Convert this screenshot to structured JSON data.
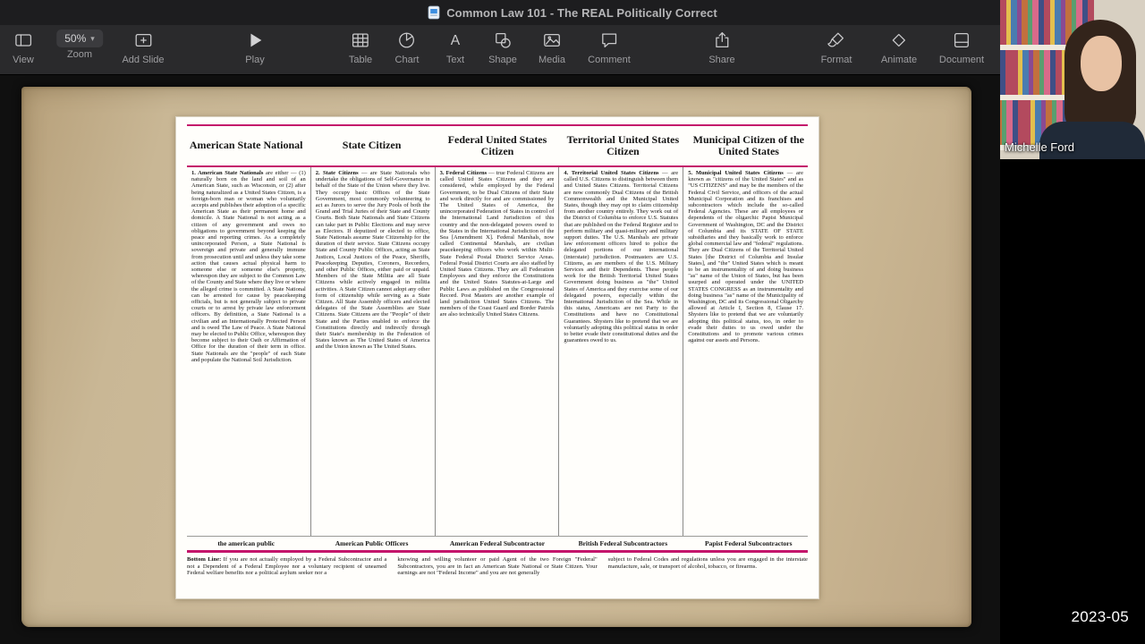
{
  "titlebar": {
    "title": "Common Law 101 - The REAL Politically Correct"
  },
  "toolbar": {
    "view_label": "View",
    "zoom_value": "50%",
    "zoom_label": "Zoom",
    "add_slide_label": "Add Slide",
    "play_label": "Play",
    "table_label": "Table",
    "chart_label": "Chart",
    "text_label": "Text",
    "shape_label": "Shape",
    "media_label": "Media",
    "comment_label": "Comment",
    "share_label": "Share",
    "format_label": "Format",
    "animate_label": "Animate",
    "document_label": "Document"
  },
  "webcam": {
    "name": "Michelle Ford"
  },
  "timestamp": "2023-05",
  "slide": {
    "columns": [
      {
        "header": "American State National",
        "lead": "1. American State Nationals",
        "body": " are either — (1) naturally born on the land and soil of an American State, such as Wisconsin, or (2) after being naturalized as a United States Citizen, is a foreign-born man or woman who voluntarily accepts and publishes their adoption of a specific American State as their permanent home and domicile. A State National is not acting as a citizen of any government and owes no obligations to government beyond keeping the peace and reporting crimes. As a completely unincorporated Person, a State National is sovereign and private and generally immune from prosecution until and unless they take some action that causes actual physical harm to someone else or someone else's property, whereupon they are subject to the Common Law of the County and State where they live or where the alleged crime is committed. A State National can be arrested for cause by peacekeeping officials, but is not generally subject to private courts or to arrest by private law enforcement officers. By definition, a State National is a civilian and an Internationally Protected Person and is owed The Law of Peace. A State National may be elected to Public Office, whereupon they become subject to their Oath or Affirmation of Office for the duration of their term in office. State Nationals are the \"people\" of each State and populate the National Soil Jurisdiction.",
        "footer": "the american public"
      },
      {
        "header": "State Citizen",
        "lead": "2. State Citizens",
        "body": " — are State Nationals who undertake the obligations of Self-Governance in behalf of the State of the Union where they live. They occupy basic Offices of the State Government, most commonly volunteering to act as Jurors to serve the Jury Pools of both the Grand and Trial Juries of their State and County Courts. Both State Nationals and State Citizens can take part in Public Elections and may serve as Electors. If deputized or elected to office, State Nationals assume State Citizenship for the duration of their service. State Citizens occupy State and County Public Offices, acting as State Justices, Local Justices of the Peace, Sheriffs, Peacekeeping Deputies, Coroners, Recorders, and other Public Offices, either paid or unpaid. Members of the State Militia are all State Citizens while actively engaged in militia activities. A State Citizen cannot adopt any other form of citizenship while serving as a State Citizen. All State Assembly officers and elected delegates of the State Assemblies are State Citizens. State Citizens are the \"People\" of their State and the Parties enabled to enforce the Constitutions directly and indirectly through their State's membership in the Federation of States known as The United States of America and the Union known as The United States.",
        "footer": "American Public Officers"
      },
      {
        "header": "Federal United States Citizen",
        "lead": "3. Federal Citizens",
        "body": " — true Federal Citizens are called United States Citizens and they are considered, while employed by the Federal Government, to be Dual Citizens of their State and work directly for and are commissioned by The United States of America, the unincorporated Federation of States in control of the International Land Jurisdiction of this country and the non-delegated powers owed to the States in the International Jurisdiction of the Sea [Amendment X]. Federal Marshals, now called Continental Marshals, are civilian peacekeeping officers who work within Multi-State Federal Postal District Service Areas. Federal Postal District Courts are also staffed by United States Citizens. They are all Federation Employees and they enforce the Constitutions and the United States Statutes-at-Large and Public Laws as published on the Congressional Record. Post Masters are another example of land jurisdiction United States Citizens. The members of the Coast Guard and Border Patrols are also technically United States Citizens.",
        "footer": "American Federal Subcontractor"
      },
      {
        "header": "Territorial United States Citizen",
        "lead": "4. Territorial United States Citizens",
        "body": " — are called U.S. Citizens to distinguish between them and United States Citizens. Territorial Citizens are now commonly Dual Citizens of the British Commonwealth and the Municipal United States, though they may opt to claim citizenship from another country entirely. They work out of the District of Columbia to enforce U.S. Statutes that are published on the Federal Register and to perform military and quasi-military and military support duties. The U.S. Marshals are private law enforcement officers hired to police the delegated portions of our international (interstate) jurisdiction. Postmasters are U.S. Citizens, as are members of the U.S. Military Services and their Dependents. These people work for the British Territorial United States Government doing business as \"the\" United States of America and they exercise some of our delegated powers, especially within the International Jurisdiction of the Sea. While in this status, Americans are not Party to the Constitutions and have no Constitutional Guarantees. Shysters like to pretend that we are voluntarily adopting this political status in order to better evade their constitutional duties and the guarantees owed to us.",
        "footer": "British Federal Subcontractors"
      },
      {
        "header": "Municipal Citizen of the United States",
        "lead": "5. Municipal United States Citizens",
        "body": " — are known as \"citizens of the United States\" and as \"US CITIZENS\" and may be the members of the Federal Civil Service, and officers of the actual Municipal Corporation and its franchises and subcontractors which include the so-called Federal Agencies. These are all employees or dependents of the oligarchic Papist Municipal Government of Washington, DC and the District of Columbia and its STATE OF STATE subsidiaries and they basically work to enforce global commercial law and \"federal\" regulations. They are Dual Citizens of the Territorial United States [the District of Columbia and Insular States], and \"the\" United States which is meant to be an instrumentality of and doing business \"as\" name of the Union of States, but has been usurped and operated under the UNITED STATES CONGRESS as an instrumentality and doing business \"as\" name of the Municipality of Washington, DC and its Congressional Oligarchy allowed at Article I, Section 8, Clause 17. Shysters like to pretend that we are voluntarily adopting this political status, too, in order to evade their duties to us owed under the Constitutions and to promote various crimes against our assets and Persons.",
        "footer": "Papist Federal Subcontractors"
      }
    ],
    "bottom_line": {
      "lead": "Bottom Line:",
      "col1": " If you are not actually employed by a Federal Subcontractor and a not a Dependent of a Federal Employee nor a voluntary recipient of unearned Federal welfare benefits nor a political asylum seeker nor a",
      "col2": "knowing and willing volunteer or paid Agent of the two Foreign \"Federal\" Subcontractors, you are in fact an American State National or State Citizen. Your earnings are not \"Federal Income\" and you are not generally",
      "col3": "subject to Federal Codes and regulations unless you are engaged in the interstate manufacture, sale, or transport of alcohol, tobacco, or firearms."
    }
  }
}
